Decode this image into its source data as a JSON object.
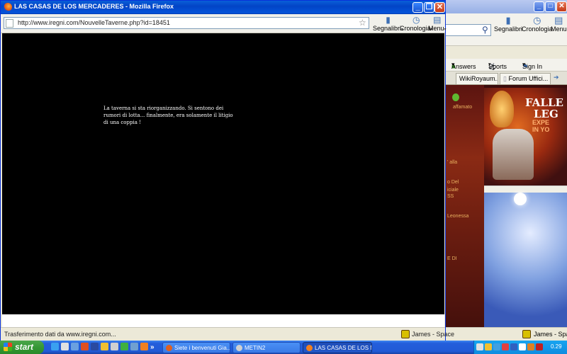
{
  "background_window": {
    "toolbar": {
      "bookmarks_label": "Segnalibri",
      "history_label": "Cronologia",
      "menu_label": "Menu"
    },
    "links": {
      "answers": "Answers",
      "sports": "Sports",
      "sign_in": "Sign In"
    },
    "tabs": [
      "WikiRoyaum...",
      "Forum Uffici..."
    ],
    "page_fragments": {
      "left_lines": [
        "affamato",
        "' alla",
        "o Del",
        "iciale",
        "SS",
        "Leonessa",
        "",
        "",
        "",
        "",
        "",
        "E DI"
      ],
      "ad_title": "FALLE",
      "ad_title2": "LEG",
      "ad_sub": "EXPE",
      "ad_sub2": "IN YO"
    },
    "status": "James - Space"
  },
  "firefox": {
    "title": "LAS CASAS DE LOS MERCADERES - Mozilla Firefox",
    "url": "http://www.iregni.com/NouvelleTaverne.php?id=18451",
    "toolbar": {
      "bookmarks_label": "Segnalibri",
      "history_label": "Cronologia",
      "menu_label": "Menu"
    },
    "message": "La taverna si sta riorganizzando. Si sentono dei rumori di lotta... finalmente, era solamente il litigio di una coppia !",
    "status_text": "Trasferimento dati da www.iregni.com...",
    "status_right": "James - Space"
  },
  "taskbar": {
    "start_label": "start",
    "quicklaunch_more": "»",
    "tasks": [
      {
        "label": "Siete i benvenuti Gia...",
        "active": false,
        "color": "#e06020"
      },
      {
        "label": "METIN2",
        "active": false,
        "color": "#d0d0d0"
      },
      {
        "label": "LAS CASAS DE LOS M...",
        "active": true,
        "color": "#f08020"
      }
    ],
    "clock": "0.29"
  }
}
